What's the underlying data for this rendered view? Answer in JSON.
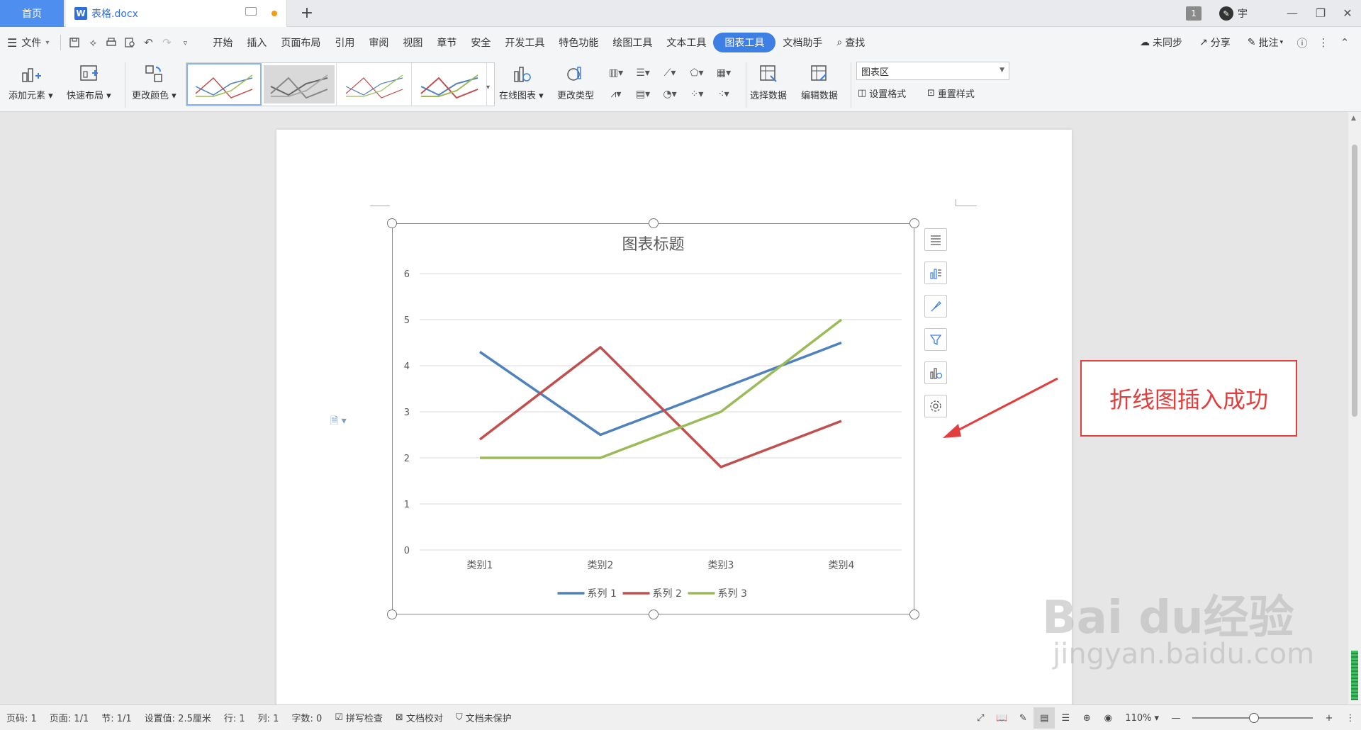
{
  "tabs": {
    "home": "首页",
    "doc_badge": "W",
    "doc_name": "表格.docx",
    "plus": "+"
  },
  "window": {
    "count": "1",
    "user": "宇",
    "minimize": "—",
    "restore": "❐",
    "close": "✕"
  },
  "menu": {
    "file": "文件",
    "items": [
      "开始",
      "插入",
      "页面布局",
      "引用",
      "审阅",
      "视图",
      "章节",
      "安全",
      "开发工具",
      "特色功能",
      "绘图工具",
      "文本工具",
      "图表工具",
      "文档助手"
    ],
    "active": "图表工具",
    "search": "查找",
    "sync": "未同步",
    "share": "分享",
    "comment": "批注"
  },
  "ribbon": {
    "add_element": "添加元素",
    "quick_layout": "快速布局",
    "change_color": "更改颜色",
    "online_chart": "在线图表",
    "change_type": "更改类型",
    "select_data": "选择数据",
    "edit_data": "编辑数据",
    "area_select": "图表区",
    "set_format": "设置格式",
    "reset_style": "重置样式"
  },
  "chart_data": {
    "type": "line",
    "title": "图表标题",
    "categories": [
      "类别1",
      "类别2",
      "类别3",
      "类别4"
    ],
    "ylim": [
      0,
      6
    ],
    "yticks": [
      "0",
      "1",
      "2",
      "3",
      "4",
      "5",
      "6"
    ],
    "grid": true,
    "legend_position": "bottom",
    "series": [
      {
        "name": "系列 1",
        "values": [
          4.3,
          2.5,
          3.5,
          4.5
        ],
        "color": "#4f81bd"
      },
      {
        "name": "系列 2",
        "values": [
          2.4,
          4.4,
          1.8,
          2.8
        ],
        "color": "#c0504d"
      },
      {
        "name": "系列 3",
        "values": [
          2,
          2,
          3,
          5
        ],
        "color": "#9bbb59"
      }
    ]
  },
  "annotation": {
    "text": "折线图插入成功",
    "color": "#e33e3e"
  },
  "status": {
    "page_no": "页码: 1",
    "pages": "页面: 1/1",
    "section": "节: 1/1",
    "setting": "设置值: 2.5厘米",
    "row": "行: 1",
    "col": "列: 1",
    "words": "字数: 0",
    "spell": "拼写检查",
    "proof": "文档校对",
    "protect": "文档未保护",
    "zoom": "110%"
  },
  "watermark": {
    "main": "Bai du经验",
    "sub": "jingyan.baidu.com"
  }
}
